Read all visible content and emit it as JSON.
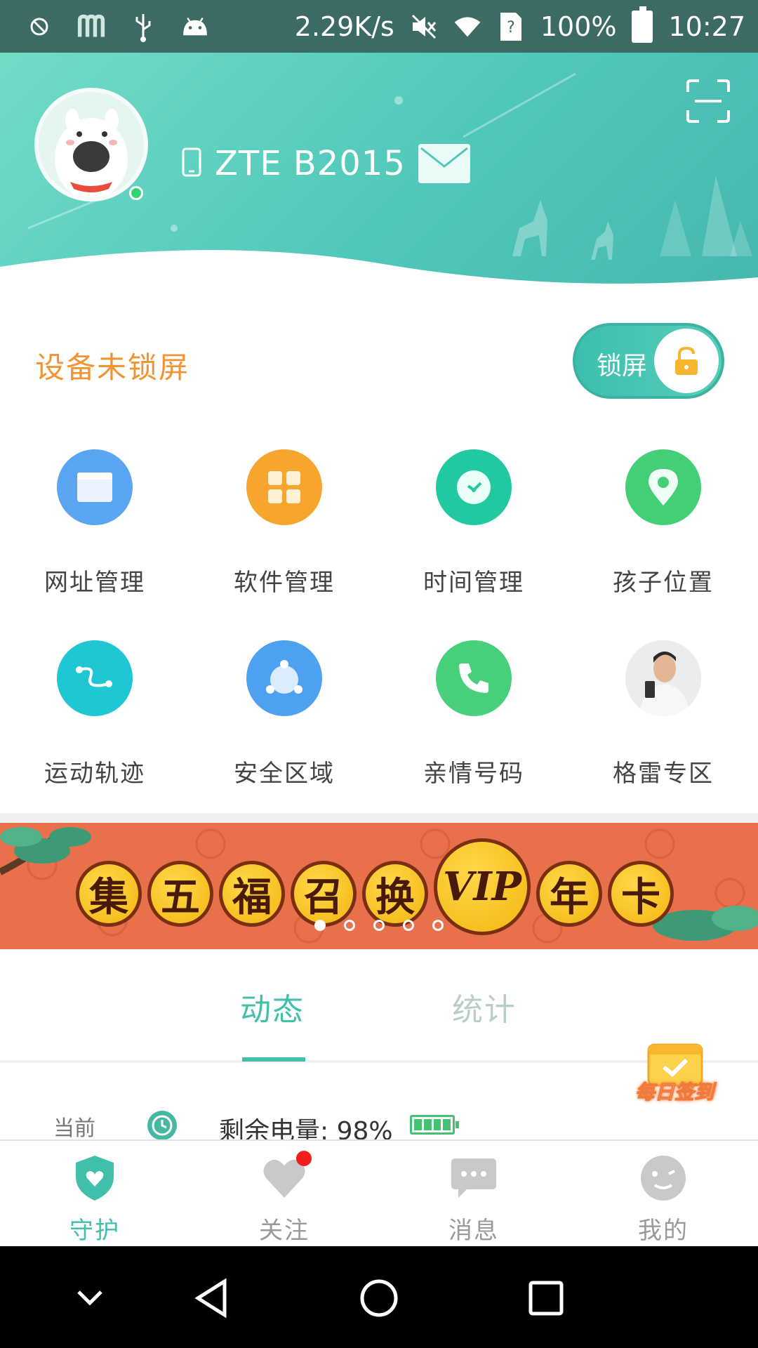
{
  "status_bar": {
    "net_speed": "2.29K/s",
    "battery": "100%",
    "time": "10:27"
  },
  "header": {
    "device_name": "ZTE B2015"
  },
  "lock": {
    "status": "设备未锁屏",
    "toggle_label": "锁屏"
  },
  "grid": {
    "items": [
      {
        "label": "网址管理",
        "icon": "browser-icon",
        "color": "#5aa5f2"
      },
      {
        "label": "软件管理",
        "icon": "apps-icon",
        "color": "#f8a52e"
      },
      {
        "label": "时间管理",
        "icon": "clock-icon",
        "color": "#22c9a0"
      },
      {
        "label": "孩子位置",
        "icon": "location-icon",
        "color": "#44cf77"
      },
      {
        "label": "运动轨迹",
        "icon": "route-icon",
        "color": "#1fc6d3"
      },
      {
        "label": "安全区域",
        "icon": "safe-zone-icon",
        "color": "#4ea1f0"
      },
      {
        "label": "亲情号码",
        "icon": "phone-icon",
        "color": "#47cf79"
      },
      {
        "label": "格雷专区",
        "icon": "promo-photo",
        "color": "#dddddd"
      }
    ]
  },
  "banner": {
    "chars": [
      "集",
      "五",
      "福",
      "召",
      "换",
      "VIP",
      "年",
      "卡"
    ],
    "page_count": 5,
    "active_index": 0
  },
  "tabs": {
    "active": "动态",
    "inactive": "统计"
  },
  "checkin": {
    "label": "每日签到"
  },
  "activity": {
    "time": "当前",
    "text": "剩余电量: 98%"
  },
  "bottom_nav": {
    "items": [
      {
        "label": "守护",
        "icon": "shield-heart-icon",
        "active": true
      },
      {
        "label": "关注",
        "icon": "heart-icon",
        "active": false,
        "badge": true
      },
      {
        "label": "消息",
        "icon": "chat-icon",
        "active": false
      },
      {
        "label": "我的",
        "icon": "face-icon",
        "active": false
      }
    ]
  },
  "colors": {
    "accent": "#42bfa9",
    "warning": "#f39434",
    "inactive": "#9a9a9a"
  }
}
